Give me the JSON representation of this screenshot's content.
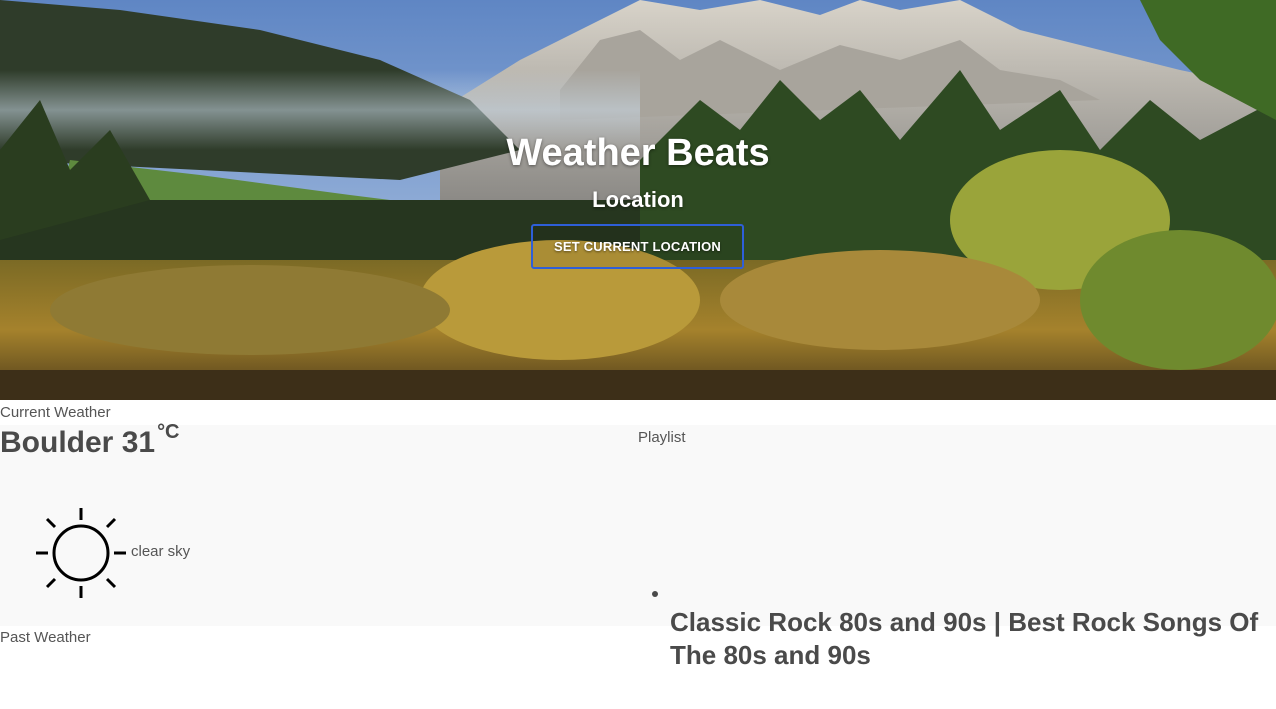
{
  "hero": {
    "title": "Weather Beats",
    "subtitle": "Location",
    "set_location_label": "SET CURRENT LOCATION",
    "button_border_color": "#2e5fd8"
  },
  "current_weather": {
    "section_label": "Current Weather",
    "city": "Boulder",
    "temperature": "31",
    "unit": "°C",
    "icon": "sun-icon",
    "description": "clear sky"
  },
  "past_weather": {
    "section_label": "Past Weather"
  },
  "playlist": {
    "section_label": "Playlist",
    "items": [
      {
        "title": "Classic Rock 80s and 90s | Best Rock Songs Of The 80s and 90s"
      }
    ]
  }
}
